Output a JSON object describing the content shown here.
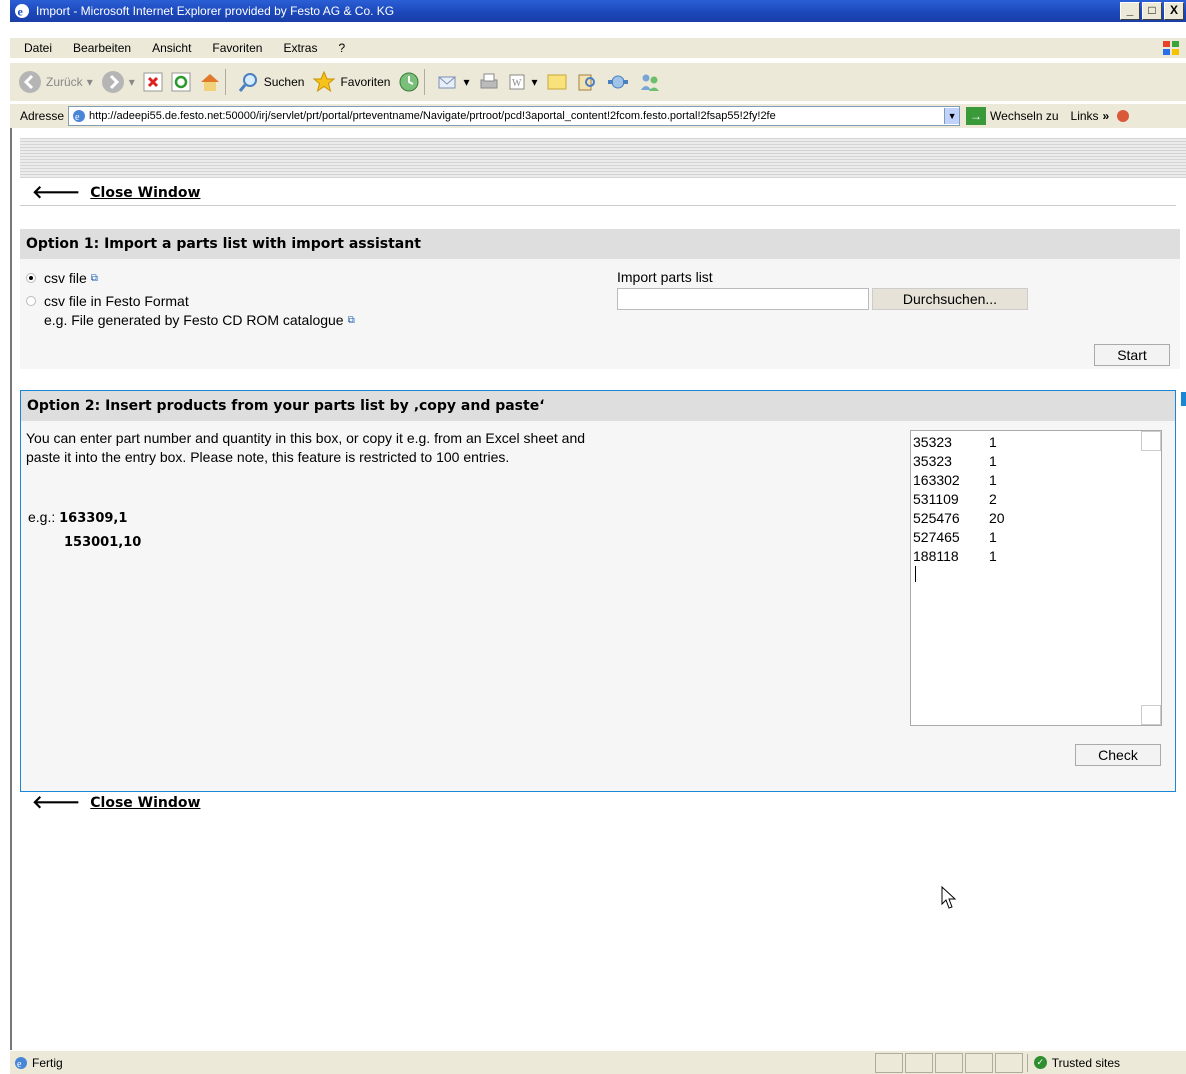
{
  "window": {
    "title": "Import - Microsoft Internet Explorer provided by Festo AG & Co. KG",
    "min": "_",
    "max": "□",
    "close": "X"
  },
  "menu": [
    "Datei",
    "Bearbeiten",
    "Ansicht",
    "Favoriten",
    "Extras",
    "?"
  ],
  "toolbar": {
    "back": "Zurück",
    "search": "Suchen",
    "favorites": "Favoriten"
  },
  "address": {
    "label": "Adresse",
    "url": "http://adeepi55.de.festo.net:50000/irj/servlet/prt/portal/prteventname/Navigate/prtroot/pcd!3aportal_content!2fcom.festo.portal!2fsap55!2fy!2fe",
    "go": "Wechseln zu",
    "links": "Links",
    "chevron": "»"
  },
  "page": {
    "close_window": "Close Window",
    "option1": {
      "title": "Option 1: Import a parts list with import assistant",
      "radio_csv": "csv file",
      "radio_festo": "csv file in Festo Format",
      "festo_note": "e.g. File generated by Festo CD ROM catalogue",
      "import_label": "Import parts list",
      "browse": "Durchsuchen...",
      "start": "Start"
    },
    "option2": {
      "title": "Option 2: Insert products from your parts list by ‚copy and paste‘",
      "description": "You can enter part number and quantity in this box, or copy it e.g. from an Excel sheet and paste it into the entry box. Please note, this feature is restricted to 100 entries.",
      "eg_label": "e.g.:",
      "eg_line1": "163309,1",
      "eg_line2": "153001,10",
      "entries": [
        {
          "part": "35323",
          "qty": "1"
        },
        {
          "part": "35323",
          "qty": "1"
        },
        {
          "part": "163302",
          "qty": "1"
        },
        {
          "part": "531109",
          "qty": "2"
        },
        {
          "part": "525476",
          "qty": "20"
        },
        {
          "part": "527465",
          "qty": "1"
        },
        {
          "part": "188118",
          "qty": "1"
        }
      ],
      "check": "Check"
    }
  },
  "status": {
    "text": "Fertig",
    "zone": "Trusted sites"
  }
}
